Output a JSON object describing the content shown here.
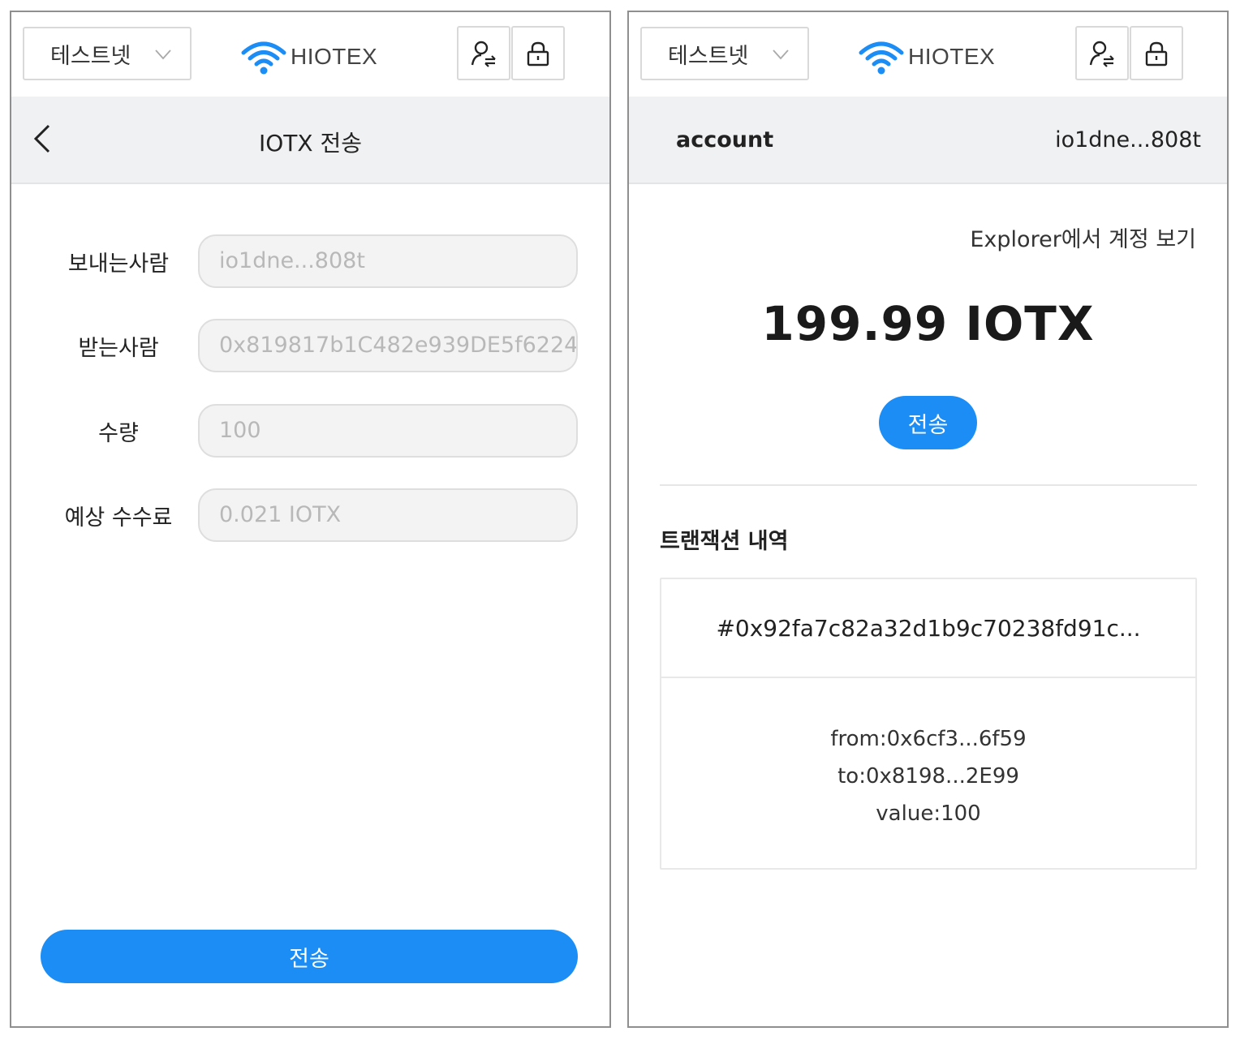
{
  "header": {
    "network_label": "테스트넷",
    "brand": "HIOTEX"
  },
  "send_screen": {
    "title": "IOTX 전송",
    "fields": [
      {
        "label": "보내는사람",
        "value": "io1dne...808t"
      },
      {
        "label": "받는사람",
        "value": "0x819817b1C482e939DE5f6224"
      },
      {
        "label": "수량",
        "value": "100"
      },
      {
        "label": "예상 수수료",
        "value": "0.021 IOTX"
      }
    ],
    "submit_label": "전송"
  },
  "account_screen": {
    "account_label": "account",
    "account_address": "io1dne...808t",
    "explorer_link": "Explorer에서 계정 보기",
    "balance": "199.99 IOTX",
    "send_label": "전송",
    "history_title": "트랜잭션 내역",
    "transactions": [
      {
        "hash": "#0x92fa7c82a32d1b9c70238fd91c...",
        "from": "from:0x6cf3...6f59",
        "to": "to:0x8198...2E99",
        "value": "value:100"
      }
    ]
  },
  "colors": {
    "accent": "#1c8df5",
    "header_bar": "#f0f1f3",
    "input_bg": "#f3f3f3"
  },
  "icons": [
    "chevron-down-icon",
    "wifi-logo-icon",
    "switch-account-icon",
    "lock-icon",
    "back-arrow-icon"
  ]
}
